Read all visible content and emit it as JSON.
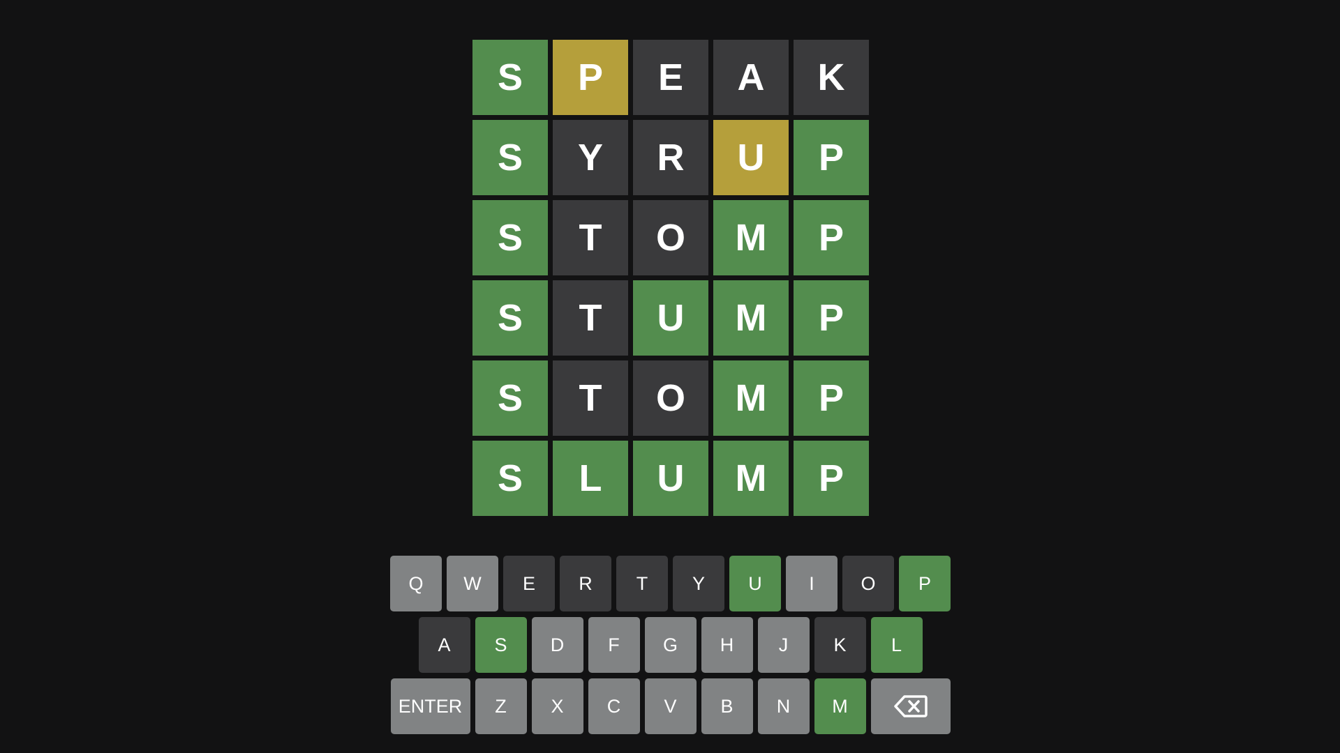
{
  "colors": {
    "background": "#121213",
    "correct": "#538d4e",
    "present": "#b59f3b",
    "absent": "#3a3a3c",
    "unused": "#818384",
    "text": "#ffffff"
  },
  "board": {
    "rows": [
      {
        "tiles": [
          {
            "letter": "S",
            "state": "correct"
          },
          {
            "letter": "P",
            "state": "present"
          },
          {
            "letter": "E",
            "state": "absent"
          },
          {
            "letter": "A",
            "state": "absent"
          },
          {
            "letter": "K",
            "state": "absent"
          }
        ]
      },
      {
        "tiles": [
          {
            "letter": "S",
            "state": "correct"
          },
          {
            "letter": "Y",
            "state": "absent"
          },
          {
            "letter": "R",
            "state": "absent"
          },
          {
            "letter": "U",
            "state": "present"
          },
          {
            "letter": "P",
            "state": "correct"
          }
        ]
      },
      {
        "tiles": [
          {
            "letter": "S",
            "state": "correct"
          },
          {
            "letter": "T",
            "state": "absent"
          },
          {
            "letter": "O",
            "state": "absent"
          },
          {
            "letter": "M",
            "state": "correct"
          },
          {
            "letter": "P",
            "state": "correct"
          }
        ]
      },
      {
        "tiles": [
          {
            "letter": "S",
            "state": "correct"
          },
          {
            "letter": "T",
            "state": "absent"
          },
          {
            "letter": "U",
            "state": "correct"
          },
          {
            "letter": "M",
            "state": "correct"
          },
          {
            "letter": "P",
            "state": "correct"
          }
        ]
      },
      {
        "tiles": [
          {
            "letter": "S",
            "state": "correct"
          },
          {
            "letter": "T",
            "state": "absent"
          },
          {
            "letter": "O",
            "state": "absent"
          },
          {
            "letter": "M",
            "state": "correct"
          },
          {
            "letter": "P",
            "state": "correct"
          }
        ]
      },
      {
        "tiles": [
          {
            "letter": "S",
            "state": "correct"
          },
          {
            "letter": "L",
            "state": "correct"
          },
          {
            "letter": "U",
            "state": "correct"
          },
          {
            "letter": "M",
            "state": "correct"
          },
          {
            "letter": "P",
            "state": "correct"
          }
        ]
      }
    ]
  },
  "keyboard": {
    "rows": [
      {
        "keys": [
          {
            "label": "Q",
            "state": "unused"
          },
          {
            "label": "W",
            "state": "unused"
          },
          {
            "label": "E",
            "state": "absent"
          },
          {
            "label": "R",
            "state": "absent"
          },
          {
            "label": "T",
            "state": "absent"
          },
          {
            "label": "Y",
            "state": "absent"
          },
          {
            "label": "U",
            "state": "correct"
          },
          {
            "label": "I",
            "state": "unused"
          },
          {
            "label": "O",
            "state": "absent"
          },
          {
            "label": "P",
            "state": "correct"
          }
        ]
      },
      {
        "keys": [
          {
            "label": "A",
            "state": "absent"
          },
          {
            "label": "S",
            "state": "correct"
          },
          {
            "label": "D",
            "state": "unused"
          },
          {
            "label": "F",
            "state": "unused"
          },
          {
            "label": "G",
            "state": "unused"
          },
          {
            "label": "H",
            "state": "unused"
          },
          {
            "label": "J",
            "state": "unused"
          },
          {
            "label": "K",
            "state": "absent"
          },
          {
            "label": "L",
            "state": "correct"
          }
        ]
      },
      {
        "keys": [
          {
            "label": "ENTER",
            "state": "unused",
            "wide": true
          },
          {
            "label": "Z",
            "state": "unused"
          },
          {
            "label": "X",
            "state": "unused"
          },
          {
            "label": "C",
            "state": "unused"
          },
          {
            "label": "V",
            "state": "unused"
          },
          {
            "label": "B",
            "state": "unused"
          },
          {
            "label": "N",
            "state": "unused"
          },
          {
            "label": "M",
            "state": "correct"
          },
          {
            "label": "",
            "icon": "backspace-icon",
            "state": "unused",
            "wide": true
          }
        ]
      }
    ]
  }
}
